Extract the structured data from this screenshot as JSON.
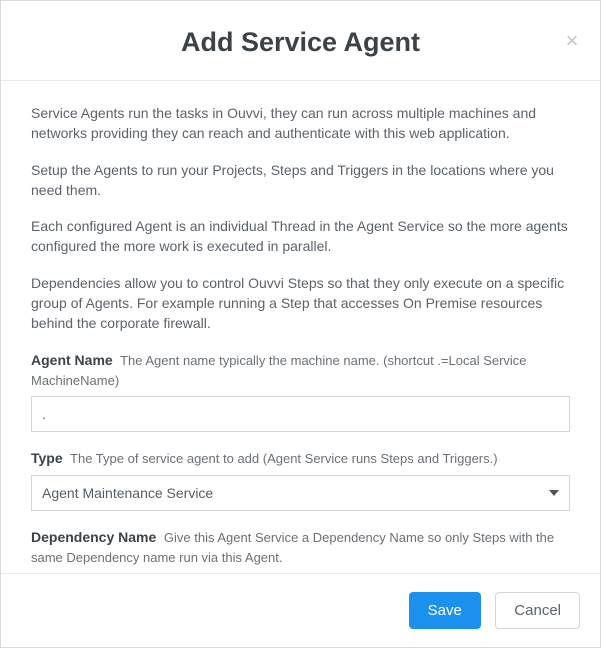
{
  "header": {
    "title": "Add Service Agent",
    "close_label": "×"
  },
  "body": {
    "paragraphs": [
      "Service Agents run the tasks in Ouvvi, they can run across multiple machines and networks providing they can reach and authenticate with this web application.",
      "Setup the Agents to run your Projects, Steps and Triggers in the locations where you need them.",
      "Each configured Agent is an individual Thread in the Agent Service so the more agents configured the more work is executed in parallel.",
      "Dependencies allow you to control Ouvvi Steps so that they only execute on a specific group of Agents. For example running a Step that accesses On Premise resources behind the corporate firewall."
    ],
    "fields": {
      "agent_name": {
        "label": "Agent Name",
        "hint": "The Agent name typically the machine name. (shortcut .=Local Service MachineName)",
        "value": "."
      },
      "type": {
        "label": "Type",
        "hint": "The Type of service agent to add (Agent Service runs Steps and Triggers.)",
        "value": "Agent Maintenance Service"
      },
      "dependency_name": {
        "label": "Dependency Name",
        "hint": "Give this Agent Service a Dependency Name so only Steps with the same Dependency name run via this Agent.",
        "value": ""
      }
    }
  },
  "footer": {
    "save_label": "Save",
    "cancel_label": "Cancel"
  }
}
